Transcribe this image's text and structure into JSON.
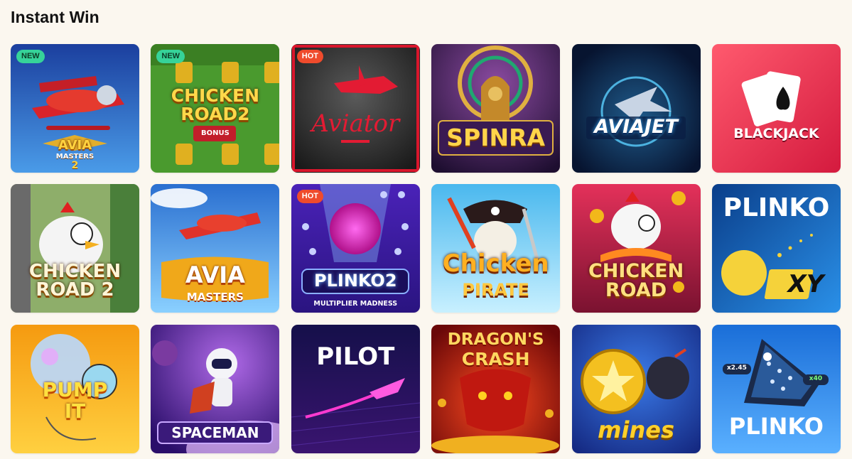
{
  "section": {
    "title": "Instant Win"
  },
  "games": [
    {
      "id": "avia-masters-2",
      "badge": "NEW",
      "title": "AVIA",
      "subtitle": "MASTERS",
      "num": "2",
      "colors": [
        "#1d4fb0",
        "#5aa7ee"
      ]
    },
    {
      "id": "chicken-road-2-bonus",
      "badge": "NEW",
      "title": "CHICKEN",
      "subtitle": "ROAD2",
      "extra": "BONUS",
      "colors": [
        "#3e8f2a",
        "#8fd048"
      ]
    },
    {
      "id": "aviator",
      "badge": "HOT",
      "title": "Aviator",
      "colors": [
        "#1a1a1a",
        "#444444"
      ]
    },
    {
      "id": "spinra",
      "title": "SPINRA",
      "colors": [
        "#2a1540",
        "#7a3d8a"
      ]
    },
    {
      "id": "aviajet",
      "title": "AVIAJET",
      "colors": [
        "#081633",
        "#1c4a7a"
      ]
    },
    {
      "id": "blackjack",
      "title": "BLACKJACK",
      "colors": [
        "#e3284a",
        "#ff6a7a"
      ]
    },
    {
      "id": "chicken-road-2",
      "title": "CHICKEN",
      "subtitle": "ROAD 2",
      "colors": [
        "#59803d",
        "#a1b47f"
      ]
    },
    {
      "id": "avia-masters",
      "title": "AVIA",
      "subtitle": "MASTERS",
      "colors": [
        "#2a7bd8",
        "#8fd0ff"
      ]
    },
    {
      "id": "plinko-2",
      "badge": "HOT",
      "title": "PLINKO2",
      "subtitle": "MULTIPLIER MADNESS",
      "colors": [
        "#3d1aa0",
        "#6b3fe0"
      ]
    },
    {
      "id": "chicken-pirate",
      "title": "Chicken",
      "subtitle": "PIRATE",
      "colors": [
        "#3aa7e0",
        "#b8ecff"
      ]
    },
    {
      "id": "chicken-road",
      "title": "CHICKEN",
      "subtitle": "ROAD",
      "colors": [
        "#e63a5a",
        "#ff8a6a"
      ]
    },
    {
      "id": "plinko-xy",
      "title": "PLINKO",
      "subtitle": "XY",
      "colors": [
        "#0f4fa8",
        "#2a8ae0"
      ]
    },
    {
      "id": "pump-it",
      "title": "PUMP",
      "subtitle": "IT",
      "colors": [
        "#f39a12",
        "#ffd24a"
      ]
    },
    {
      "id": "spaceman",
      "title": "SPACEMAN",
      "colors": [
        "#4b1a9a",
        "#9a4ad8"
      ]
    },
    {
      "id": "pilot",
      "title": "PILOT",
      "colors": [
        "#1a1058",
        "#4a1a8a"
      ]
    },
    {
      "id": "dragons-crash",
      "title": "DRAGON'S",
      "subtitle": "CRASH",
      "colors": [
        "#8a1010",
        "#e03020"
      ]
    },
    {
      "id": "mines",
      "title": "mines",
      "colors": [
        "#1a3aa0",
        "#3a7ae8"
      ]
    },
    {
      "id": "plinko",
      "title": "PLINKO",
      "chips": [
        "x2.45",
        "x40"
      ],
      "colors": [
        "#1a73d8",
        "#5ab0ff"
      ]
    }
  ]
}
